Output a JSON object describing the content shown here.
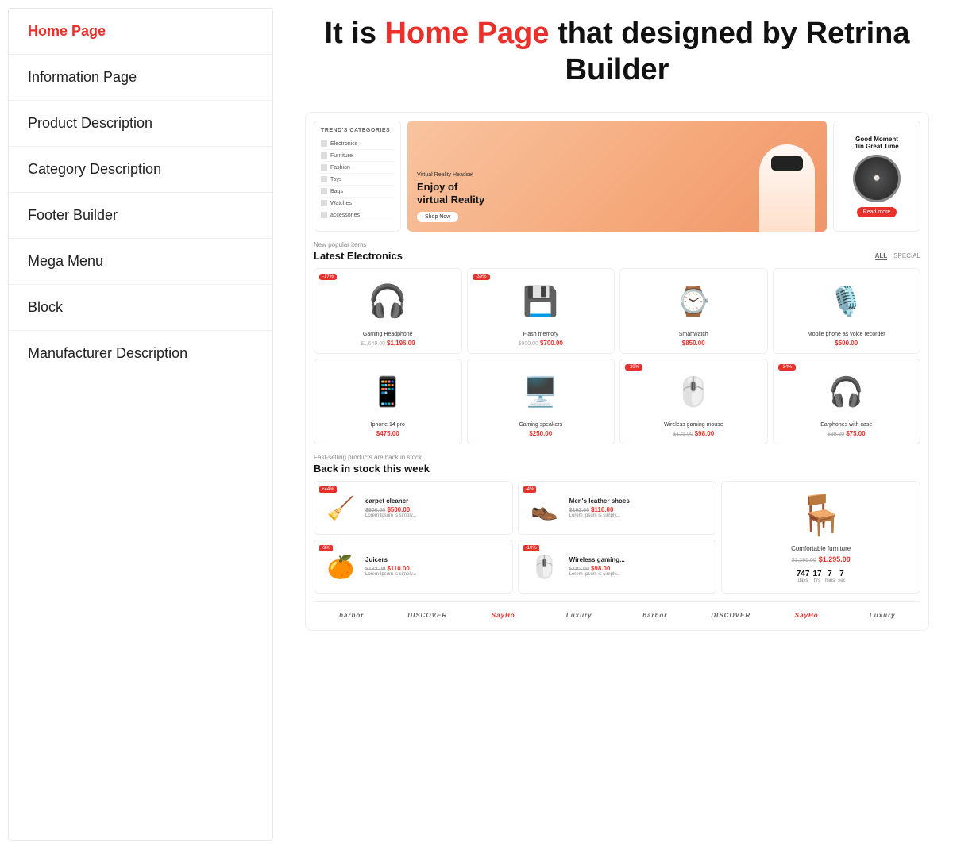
{
  "sidebar": {
    "items": [
      {
        "id": "home-page",
        "label": "Home Page",
        "active": true
      },
      {
        "id": "information-page",
        "label": "Information Page",
        "active": false
      },
      {
        "id": "product-description",
        "label": "Product Description",
        "active": false
      },
      {
        "id": "category-description",
        "label": "Category Description",
        "active": false
      },
      {
        "id": "footer-builder",
        "label": "Footer Builder",
        "active": false
      },
      {
        "id": "mega-menu",
        "label": "Mega Menu",
        "active": false
      },
      {
        "id": "block",
        "label": "Block",
        "active": false
      },
      {
        "id": "manufacturer-description",
        "label": "Manufacturer Description",
        "active": false
      }
    ]
  },
  "main": {
    "heading_prefix": "It is ",
    "heading_highlight": "Home Page",
    "heading_suffix": " that designed by Retrina Builder"
  },
  "preview": {
    "categories": {
      "title": "TREND'S CATEGORIES",
      "items": [
        {
          "label": "Electronics"
        },
        {
          "label": "Furniture"
        },
        {
          "label": "Fashion"
        },
        {
          "label": "Toys"
        },
        {
          "label": "Bags"
        },
        {
          "label": "Watches"
        },
        {
          "label": "accessories"
        }
      ]
    },
    "hero": {
      "label": "Virtual Reality Headset",
      "title": "Enjoy of virtual Reality",
      "button": "Shop Now"
    },
    "watch_panel": {
      "title": "Good Moment 1in Great Time",
      "button": "Read more"
    },
    "latest": {
      "subtitle": "New popular items",
      "title": "Latest Electronics",
      "tabs": [
        "ALL",
        "SPECIAL"
      ],
      "products": [
        {
          "name": "Gaming Headphone",
          "old_price": "$1,649.00",
          "price": "$1,196.00",
          "badge": "-17%",
          "icon": "🎧"
        },
        {
          "name": "Flash memory",
          "old_price": "$900.00",
          "price": "$700.00",
          "badge": "-39%",
          "icon": "💾"
        },
        {
          "name": "Smartwatch",
          "old_price": "",
          "price": "$850.00",
          "badge": "",
          "icon": "⌚"
        },
        {
          "name": "Mobile phone as voice recorder",
          "old_price": "",
          "price": "$500.00",
          "badge": "",
          "icon": "🎙️"
        },
        {
          "name": "Iphone 14 pro",
          "old_price": "",
          "price": "$475.00",
          "badge": "",
          "icon": "📱"
        },
        {
          "name": "Gaming speakers",
          "old_price": "",
          "price": "$250.00",
          "badge": "",
          "icon": "🖥️"
        },
        {
          "name": "Wireless gaming mouse",
          "old_price": "$125.00",
          "price": "$98.00",
          "badge": "-39%",
          "icon": "🖱️"
        },
        {
          "name": "Earphones with case",
          "old_price": "$99.80",
          "price": "$75.00",
          "badge": "-34%",
          "icon": "🎧"
        }
      ]
    },
    "back_in_stock": {
      "subtitle": "Fast-selling products are back in stock",
      "title": "Back in stock this week",
      "col1": [
        {
          "name": "carpet cleaner",
          "old_price": "$900.00",
          "price": "$500.00",
          "desc": "Lorem Ipsum is simply...",
          "badge": "+44%",
          "icon": "🧹"
        },
        {
          "name": "Juicers",
          "old_price": "$132.00",
          "price": "$110.00",
          "desc": "Lorem Ipsum is simply...",
          "badge": "-9%",
          "icon": "🍊"
        }
      ],
      "col2": [
        {
          "name": "Men's leather shoes",
          "old_price": "$192.00",
          "price": "$116.00",
          "desc": "Lorem Ipsum is simply...",
          "badge": "-4%",
          "icon": "👞"
        },
        {
          "name": "Wireless gaming...",
          "old_price": "$102.00",
          "price": "$98.00",
          "desc": "Lorem Ipsum is simply...",
          "badge": "-10%",
          "icon": "🖱️"
        }
      ],
      "featured": {
        "name": "Comfortable furniture",
        "old_price": "$1,295.00",
        "price": "$1,295.00",
        "icon": "🪑",
        "countdown": [
          {
            "num": "747",
            "label": "days"
          },
          {
            "num": "17",
            "label": "hrs"
          },
          {
            "num": "7",
            "label": "mins"
          },
          {
            "num": "7",
            "label": "sec"
          }
        ]
      }
    },
    "brands": [
      "harbor",
      "DISCOVER",
      "SayHo",
      "Luxury",
      "harbor",
      "DISCOVER",
      "SayHo",
      "Luxury"
    ]
  }
}
